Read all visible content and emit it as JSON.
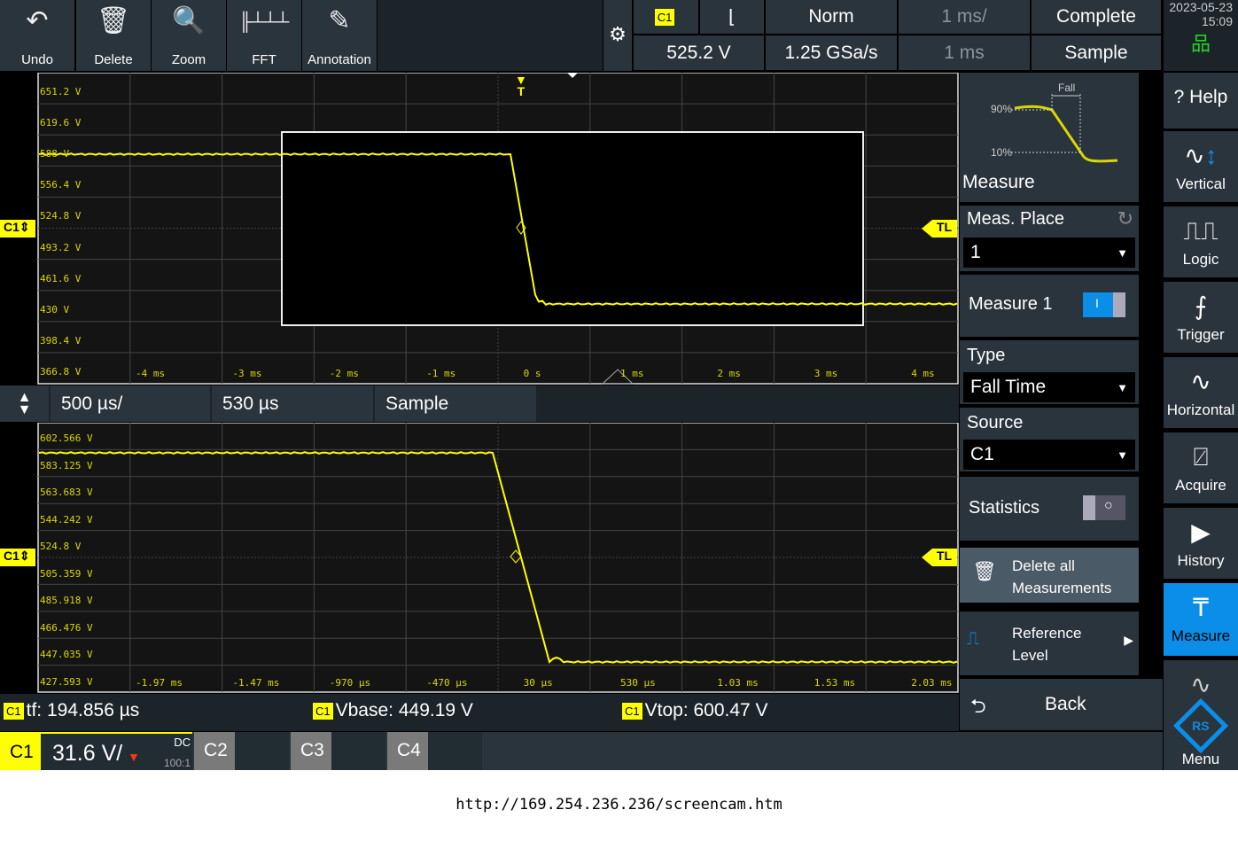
{
  "toolbar": [
    {
      "label": "Undo",
      "icon": "undo-icon"
    },
    {
      "label": "Delete",
      "icon": "trash-icon"
    },
    {
      "label": "Zoom",
      "icon": "zoom-icon"
    },
    {
      "label": "FFT",
      "icon": "fft-icon"
    },
    {
      "label": "Annotation",
      "icon": "pencil-icon"
    }
  ],
  "status": {
    "trigger_source": "C1",
    "trigger_slope": "falling",
    "trigger_mode": "Norm",
    "timebase": "1 ms/",
    "acq_state": "Complete",
    "trigger_level": "525.2 V",
    "sample_rate": "1.25 GSa/s",
    "record": "1 ms",
    "acq_mode": "Sample",
    "date": "2023-05-23",
    "time": "15:09"
  },
  "upper": {
    "y_labels": [
      "651.2 V",
      "619.6 V",
      "588 V",
      "556.4 V",
      "524.8 V",
      "493.2 V",
      "461.6 V",
      "430 V",
      "398.4 V",
      "366.8 V"
    ],
    "x_labels": [
      "-4 ms",
      "-3 ms",
      "-2 ms",
      "-1 ms",
      "0 s",
      "1 ms",
      "2 ms",
      "3 ms",
      "4 ms"
    ],
    "channel_marker": "C1",
    "trigger_level_marker": "TL",
    "trigger_marker": "T"
  },
  "zoom_bar": {
    "timebase": "500 µs/",
    "position": "530 µs",
    "mode": "Sample"
  },
  "lower": {
    "y_labels": [
      "602.566 V",
      "583.125 V",
      "563.683 V",
      "544.242 V",
      "524.8 V",
      "505.359 V",
      "485.918 V",
      "466.476 V",
      "447.035 V",
      "427.593 V"
    ],
    "x_labels": [
      "-1.97 ms",
      "-1.47 ms",
      "-970 µs",
      "-470 µs",
      "30 µs",
      "530 µs",
      "1.03 ms",
      "1.53 ms",
      "2.03 ms"
    ],
    "channel_marker": "C1",
    "trigger_level_marker": "TL"
  },
  "measurements": [
    {
      "src": "C1",
      "text": "tf: 194.856 µs"
    },
    {
      "src": "C1",
      "text": "Vbase: 449.19 V"
    },
    {
      "src": "C1",
      "text": "Vtop: 600.47 V"
    }
  ],
  "channels": {
    "c1": {
      "label": "C1",
      "scale": "31.6 V/",
      "coupling": "DC",
      "probe": "100:1"
    },
    "c2": "C2",
    "c3": "C3",
    "c4": "C4"
  },
  "panel": {
    "diagram": {
      "fall": "Fall",
      "p90": "90%",
      "p10": "10%"
    },
    "title": "Measure",
    "meas_place_label": "Meas. Place",
    "meas_place_value": "1",
    "measure1_label": "Measure 1",
    "measure1_on": true,
    "type_label": "Type",
    "type_value": "Fall Time",
    "source_label": "Source",
    "source_value": "C1",
    "statistics_label": "Statistics",
    "statistics_on": false,
    "delete_all": "Delete all Measurements",
    "reference_level": "Reference Level",
    "back": "Back"
  },
  "sidebar": [
    {
      "label": "Help",
      "icon": "help-icon"
    },
    {
      "label": "Vertical",
      "icon": "vertical-icon"
    },
    {
      "label": "Logic",
      "icon": "logic-icon"
    },
    {
      "label": "Trigger",
      "icon": "trigger-icon"
    },
    {
      "label": "Horizontal",
      "icon": "horizontal-icon"
    },
    {
      "label": "Acquire",
      "icon": "acquire-icon"
    },
    {
      "label": "History",
      "icon": "history-icon"
    },
    {
      "label": "Measure",
      "icon": "caliper-icon",
      "active": true
    },
    {
      "label": "Menu",
      "icon": "rs-logo-icon"
    }
  ],
  "url": "http://169.254.236.236/screencam.htm",
  "colors": {
    "trace": "#ffff00",
    "accent": "#0a8ee8",
    "panel": "#2a343c"
  }
}
